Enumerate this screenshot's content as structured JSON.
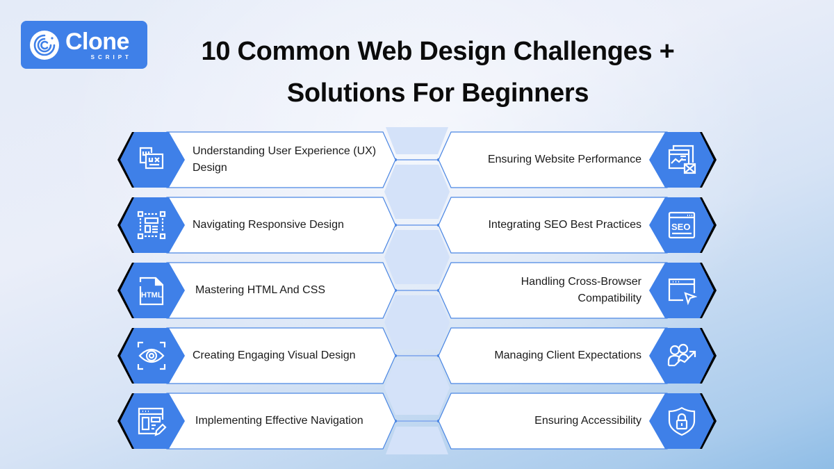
{
  "brand": {
    "name": "Clone",
    "tagline": "SCRIPT",
    "color": "#3f80e8"
  },
  "title": {
    "line1": "10 Common Web Design Challenges +",
    "line2": "Solutions For Beginners"
  },
  "colors": {
    "accent": "#3f80e8",
    "hex_fill": "#d4e2f9",
    "card_border": "#4a86e3",
    "card_bg": "#ffffff",
    "text": "#1a1a1a"
  },
  "left_items": [
    {
      "label": "Understanding User Experience (UX) Design",
      "icon": "ui-ux-icon"
    },
    {
      "label": "Navigating Responsive Design",
      "icon": "responsive-layout-icon"
    },
    {
      "label": "Mastering HTML And CSS",
      "icon": "html-file-icon"
    },
    {
      "label": "Creating Engaging Visual Design",
      "icon": "eye-focus-icon"
    },
    {
      "label": "Implementing Effective Navigation",
      "icon": "web-page-edit-icon"
    }
  ],
  "right_items": [
    {
      "label": "Ensuring Website Performance",
      "icon": "website-performance-icon"
    },
    {
      "label": "Integrating SEO Best Practices",
      "icon": "seo-icon"
    },
    {
      "label": "Handling Cross-Browser Compatibility",
      "icon": "browser-cursor-icon"
    },
    {
      "label": "Managing Client Expectations",
      "icon": "client-growth-icon"
    },
    {
      "label": "Ensuring Accessibility",
      "icon": "shield-lock-icon"
    }
  ]
}
